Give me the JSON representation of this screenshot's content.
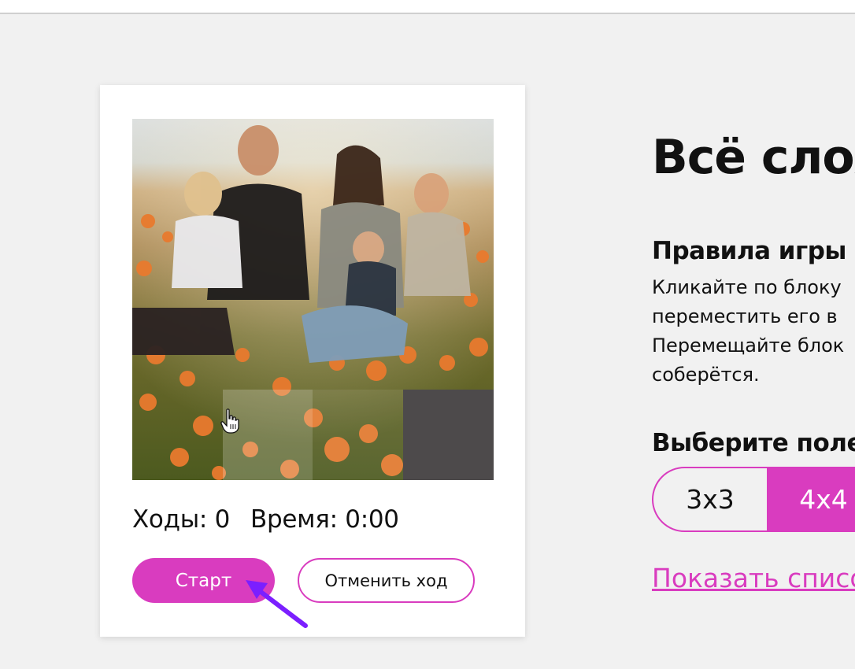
{
  "colors": {
    "accent": "#d93cbf",
    "background": "#f1f1f1",
    "card": "#ffffff",
    "empty_tile": "#4d4a4b",
    "annotation_arrow": "#7b1fff"
  },
  "game": {
    "moves_label": "Ходы: 0",
    "time_label": "Время: 0:00",
    "start_label": "Старт",
    "undo_label": "Отменить ход",
    "grid_size": 4
  },
  "page": {
    "title": "Всё слож",
    "rules_heading": "Правила игры",
    "rules_lines": [
      "Кликайте по блоку",
      "переместить его в",
      "Перемещайте блок",
      "соберётся."
    ],
    "size_heading": "Выберите поле",
    "size_options": [
      "3x3",
      "4x4"
    ],
    "selected_size": "4x4",
    "show_link": "Показать списо"
  },
  "icons": {
    "pointer": "hand-pointer-icon",
    "arrow": "annotation-arrow-icon"
  }
}
